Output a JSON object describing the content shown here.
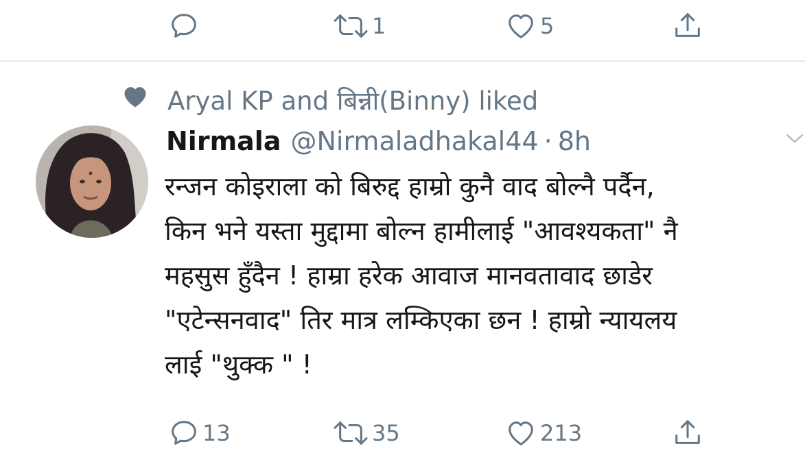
{
  "previous_tweet": {
    "actions": {
      "reply_count": "",
      "retweet_count": "1",
      "like_count": "5"
    }
  },
  "social_context": {
    "text": "Aryal KP and बिन्नी(Binny) liked",
    "icon": "heart-icon"
  },
  "tweet": {
    "display_name": "Nirmala",
    "handle": "@Nirmaladhakal44",
    "separator": "·",
    "time": "8h",
    "text_lines": [
      "रन्जन कोइराला को बिरुद्द हाम्रो कुनै वाद  बोल्नै पर्दैन,",
      "किन भने यस्ता मुद्दामा बोल्न हामीलाई \"आवश्यकता\" नै",
      "महसुस हुँदैन ! हाम्रा हरेक आवाज मानवतावाद छाडेर",
      "\"एटेन्सनवाद\" तिर मात्र लम्किएका छन ! हाम्रो न्यायलय",
      "लाई \"थुक्क \" !"
    ],
    "actions": {
      "reply_count": "13",
      "retweet_count": "35",
      "like_count": "213"
    }
  },
  "colors": {
    "secondary_text": "#657786",
    "primary_text": "#14171a",
    "divider": "#e1e8ed",
    "caret": "#aab8c2"
  }
}
